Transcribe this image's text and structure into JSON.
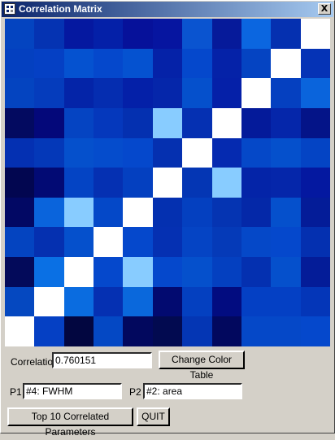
{
  "window": {
    "title": "Correlation Matrix",
    "close_label": "X"
  },
  "matrix": {
    "rows": 11,
    "cols": 11,
    "cells": [
      [
        "#0444c0",
        "#0533b2",
        "#0518a0",
        "#0420a8",
        "#06119a",
        "#0615a0",
        "#0a54d0",
        "#061a9a",
        "#0b66e0",
        "#0530b0",
        "#ffffff"
      ],
      [
        "#0440c0",
        "#0540c4",
        "#0552d0",
        "#0548cc",
        "#0552d0",
        "#0522a8",
        "#0548cc",
        "#0522a8",
        "#0544c2",
        "#ffffff",
        "#0533b6"
      ],
      [
        "#0444c0",
        "#053cbc",
        "#0424a8",
        "#052db0",
        "#0420a8",
        "#0526aa",
        "#0550cc",
        "#0520a8",
        "#ffffff",
        "#0540c0",
        "#0a64dc"
      ],
      [
        "#030a60",
        "#04087a",
        "#0544c2",
        "#0538bc",
        "#0430b0",
        "#88ccff",
        "#0530b2",
        "#ffffff",
        "#041a9a",
        "#0526aa",
        "#041488"
      ],
      [
        "#0430b2",
        "#0438b8",
        "#0550cc",
        "#054ccc",
        "#0548cc",
        "#0530b0",
        "#ffffff",
        "#052ab0",
        "#0548c8",
        "#0550cc",
        "#0444c4"
      ],
      [
        "#020650",
        "#020a74",
        "#0444c4",
        "#0530b2",
        "#0440c0",
        "#ffffff",
        "#0436b4",
        "#88ccff",
        "#0424a8",
        "#0526aa",
        "#0418a0"
      ],
      [
        "#020864",
        "#0a64dc",
        "#88ccff",
        "#0448c8",
        "#ffffff",
        "#0430b0",
        "#0440c0",
        "#0534b2",
        "#0428a8",
        "#0550cc",
        "#041c98"
      ],
      [
        "#0444c0",
        "#0530b0",
        "#0550cc",
        "#ffffff",
        "#0548cc",
        "#0530b2",
        "#0544c4",
        "#053ab8",
        "#0548c8",
        "#0548cc",
        "#0430b0"
      ],
      [
        "#030a5a",
        "#0a70e4",
        "#ffffff",
        "#0548cc",
        "#88ccff",
        "#0548cc",
        "#0550cc",
        "#0440c0",
        "#0430b0",
        "#0550cc",
        "#041c98"
      ],
      [
        "#0548c0",
        "#ffffff",
        "#0a6ce0",
        "#0530b2",
        "#0a68dc",
        "#020a70",
        "#0440c0",
        "#020c80",
        "#0440c4",
        "#0440c4",
        "#0436b8"
      ],
      [
        "#ffffff",
        "#0540c4",
        "#020640",
        "#0448c4",
        "#02085e",
        "#020a50",
        "#0436b4",
        "#02085e",
        "#0548c8",
        "#0548c8",
        "#0548cc"
      ]
    ]
  },
  "correlation": {
    "label": "Correlation",
    "value": "0.760151"
  },
  "change_color_table_label": "Change Color Table",
  "p1": {
    "label": "P1",
    "value": "#4: FWHM"
  },
  "p2": {
    "label": "P2",
    "value": "#2: area"
  },
  "top10_label": "Top 10 Correlated Parameters",
  "quit_label": "QUIT"
}
